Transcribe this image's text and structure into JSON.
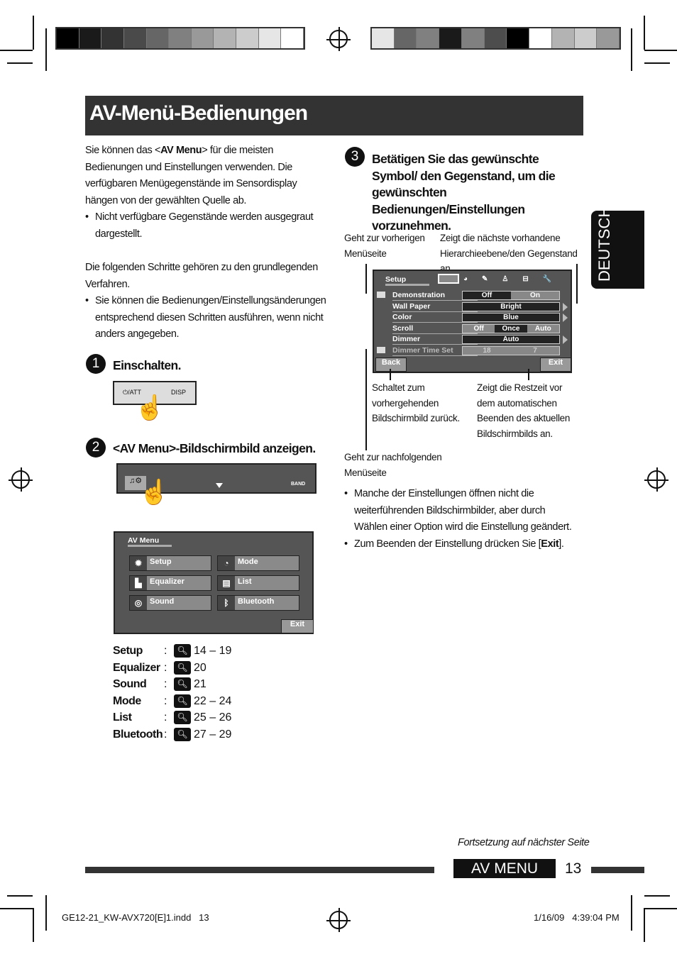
{
  "title": "AV-Menü-Bedienungen",
  "intro": [
    "Sie können das <",
    "AV Menu",
    "> für die meisten Bedienungen und Einstellungen verwenden. Die verfügbaren Menügegenstände im Sensordisplay hängen von der gewählten Quelle ab."
  ],
  "intro_bullet": "Nicht verfügbare Gegenstände werden ausgegraut dargestellt.",
  "para2": "Die folgenden Schritte gehören zu den grundlegenden Verfahren.",
  "para2_bullet": "Sie können die Bedienungen/Einstellungsänderungen entsprechend diesen Schritten ausführen, wenn nicht anders angegeben.",
  "steps": [
    {
      "num": "1",
      "text": "Einschalten."
    },
    {
      "num": "2",
      "text": "<AV Menu>-Bildschirmbild anzeigen."
    },
    {
      "num": "3",
      "text": "Betätigen Sie das gewünschte Symbol/ den Gegenstand, um die gewünschten Bedienungen/Einstellungen vorzunehmen."
    }
  ],
  "panel": {
    "att": "⏻/ATT",
    "disp": "DISP",
    "band": "BAND"
  },
  "av_menu": {
    "title": "AV Menu",
    "items": [
      {
        "label": "Setup",
        "icon": "gear-icon"
      },
      {
        "label": "Mode",
        "icon": "mode-icon"
      },
      {
        "label": "Equalizer",
        "icon": "equalizer-icon"
      },
      {
        "label": "List",
        "icon": "list-icon"
      },
      {
        "label": "Sound",
        "icon": "sound-icon"
      },
      {
        "label": "Bluetooth",
        "icon": "bluetooth-icon"
      }
    ],
    "exit": "Exit"
  },
  "refs": [
    {
      "name": "Setup",
      "pages": "14 – 19"
    },
    {
      "name": "Equalizer",
      "pages": "20"
    },
    {
      "name": "Sound",
      "pages": "21"
    },
    {
      "name": "Mode",
      "pages": "22 – 24"
    },
    {
      "name": "List",
      "pages": "25 – 26"
    },
    {
      "name": "Bluetooth",
      "pages": "27 – 29"
    }
  ],
  "setup_screen": {
    "title": "Setup",
    "rows": [
      {
        "label": "Demonstration",
        "values": [
          "Off",
          "On"
        ],
        "selected": 0
      },
      {
        "label": "Wall Paper",
        "values": [
          "Bright"
        ]
      },
      {
        "label": "Color",
        "values": [
          "Blue"
        ]
      },
      {
        "label": "Scroll",
        "values": [
          "Off",
          "Once",
          "Auto"
        ],
        "selected": 1
      },
      {
        "label": "Dimmer",
        "values": [
          "Auto"
        ]
      },
      {
        "label": "Dimmer Time Set",
        "values": [
          "18",
          "7"
        ]
      }
    ],
    "back": "Back",
    "exit": "Exit"
  },
  "callouts": {
    "prev": "Geht zur vorherigen Menüseite",
    "next_level": "Zeigt die nächste vorhandene Hierarchieebene/den Gegenstand an",
    "back": "Schaltet zum vorhergehenden Bildschirmbild zurück.",
    "timer": "Zeigt die Restzeit vor dem automatischen Beenden des aktuellen Bildschirmbilds an.",
    "next_page": "Geht zur nachfolgenden Menüseite"
  },
  "notes": [
    "Manche der Einstellungen öffnen nicht die weiterführenden Bildschirmbilder, aber durch Wählen einer Option wird die Einstellung geändert.",
    "Zum Beenden der Einstellung drücken Sie [",
    "Exit",
    "]."
  ],
  "side_tab": "DEUTSCH",
  "continued": "Fortsetzung auf nächster Seite",
  "footer": {
    "section": "AV MENU",
    "page": "13"
  },
  "slug": {
    "file": "GE12-21_KW-AVX720[E]1.indd   13",
    "date": "1/16/09   4:39:04 PM"
  },
  "colors": {
    "bar_left": [
      "#000",
      "#1a1a1a",
      "#333",
      "#4a4a4a",
      "#666",
      "#808080",
      "#999",
      "#b3b3b3",
      "#ccc",
      "#e6e6e6",
      "#fff"
    ],
    "bar_right": [
      "#e6e6e6",
      "#666",
      "#808080",
      "#1a1a1a",
      "#808080",
      "#4d4d4d",
      "#000",
      "#fff",
      "#b3b3b3",
      "#ccc",
      "#999"
    ]
  }
}
